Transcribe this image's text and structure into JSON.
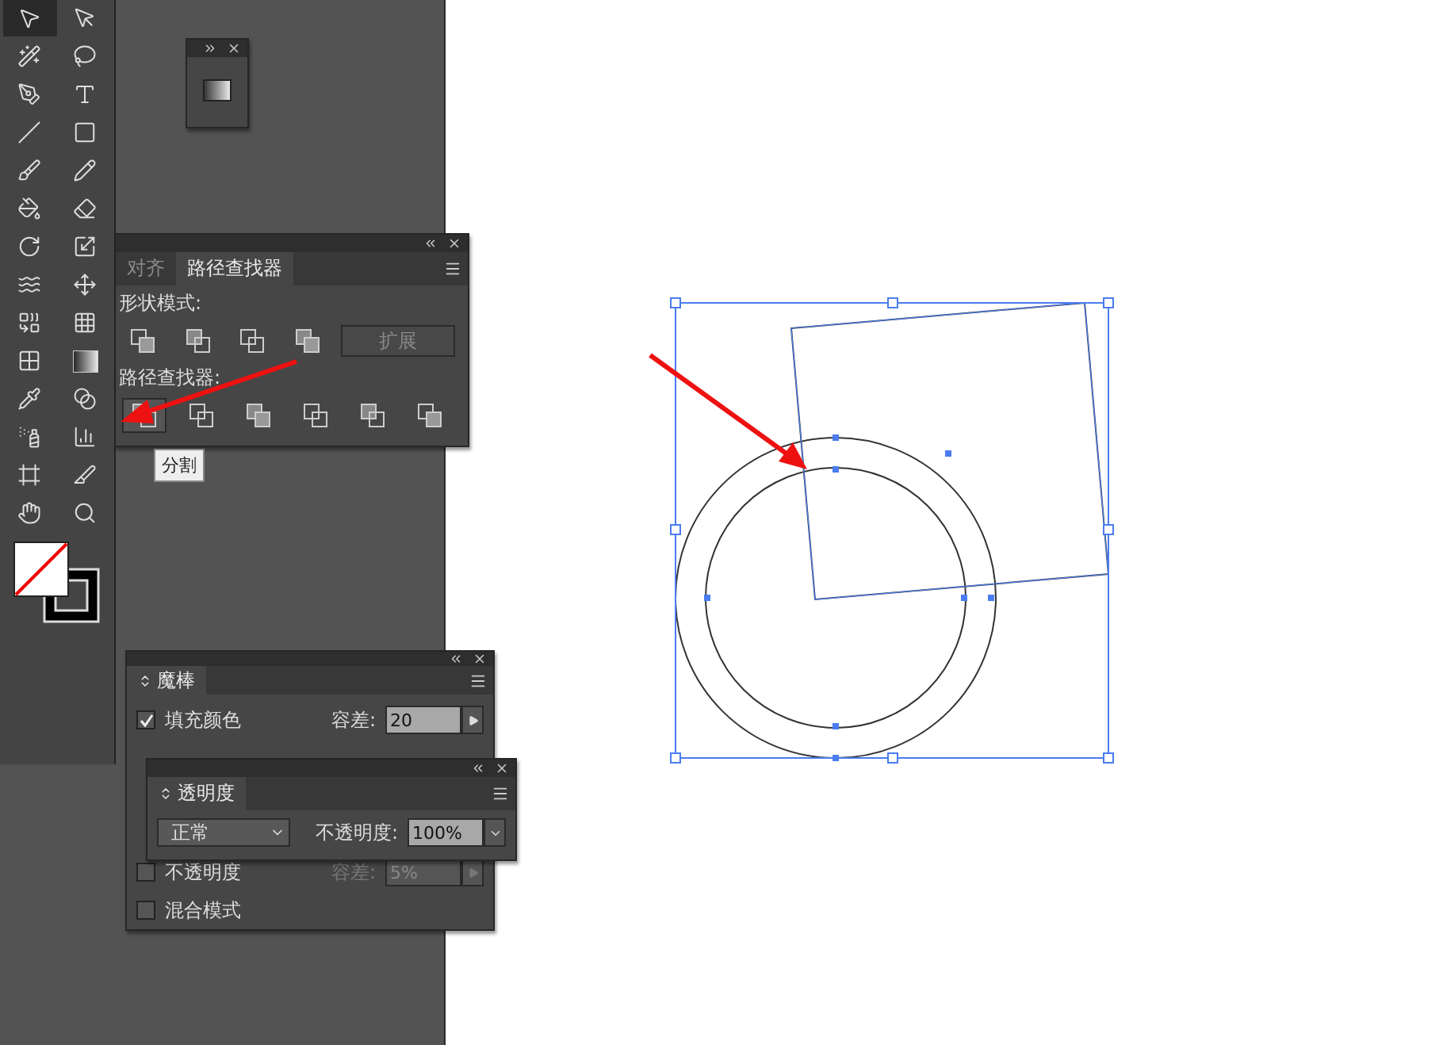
{
  "tools": [
    {
      "kind": "selection",
      "selected": true
    },
    {
      "kind": "direct-selection",
      "selected": false
    },
    {
      "kind": "magic-wand",
      "selected": false
    },
    {
      "kind": "lasso",
      "selected": false
    },
    {
      "kind": "pen",
      "selected": false
    },
    {
      "kind": "type",
      "selected": false
    },
    {
      "kind": "line",
      "selected": false
    },
    {
      "kind": "rectangle",
      "selected": false
    },
    {
      "kind": "brush",
      "selected": false
    },
    {
      "kind": "pencil",
      "selected": false
    },
    {
      "kind": "blob",
      "selected": false
    },
    {
      "kind": "eraser",
      "selected": false
    },
    {
      "kind": "rotate",
      "selected": false
    },
    {
      "kind": "scale",
      "selected": false
    },
    {
      "kind": "warp",
      "selected": false
    },
    {
      "kind": "free-transform",
      "selected": false
    },
    {
      "kind": "shape-builder",
      "selected": false
    },
    {
      "kind": "perspective",
      "selected": false
    },
    {
      "kind": "mesh",
      "selected": false
    },
    {
      "kind": "gradient",
      "selected": false
    },
    {
      "kind": "eyedropper",
      "selected": false
    },
    {
      "kind": "blend",
      "selected": false
    },
    {
      "kind": "symbol",
      "selected": false
    },
    {
      "kind": "graph",
      "selected": false
    },
    {
      "kind": "artboard",
      "selected": false
    },
    {
      "kind": "slice",
      "selected": false
    },
    {
      "kind": "hand",
      "selected": false
    },
    {
      "kind": "zoom",
      "selected": false
    }
  ],
  "pathfinder_panel": {
    "tabs": [
      {
        "label": "对齐",
        "selected": false
      },
      {
        "label": "路径查找器",
        "selected": true
      }
    ],
    "shape_modes_label": "形状模式:",
    "expand_button": "扩展",
    "pathfinders_label": "路径查找器:",
    "pathfinder_buttons": [
      {
        "selected": true
      },
      {
        "selected": false
      },
      {
        "selected": false
      },
      {
        "selected": false
      },
      {
        "selected": false
      },
      {
        "selected": false
      }
    ],
    "tooltip": "分割"
  },
  "magic_wand_panel": {
    "title": "魔棒",
    "rows": [
      {
        "label": "填充颜色",
        "checked": true,
        "tolerance_label": "容差:",
        "tolerance": "20",
        "disabled": false
      },
      {
        "label": "不透明度",
        "checked": false,
        "tolerance_label": "容差:",
        "tolerance": "5%",
        "disabled": true
      },
      {
        "label": "混合模式",
        "checked": false
      }
    ]
  },
  "transparency_panel": {
    "title": "透明度",
    "blend_mode": "正常",
    "opacity_label": "不透明度:",
    "opacity": "100%"
  }
}
